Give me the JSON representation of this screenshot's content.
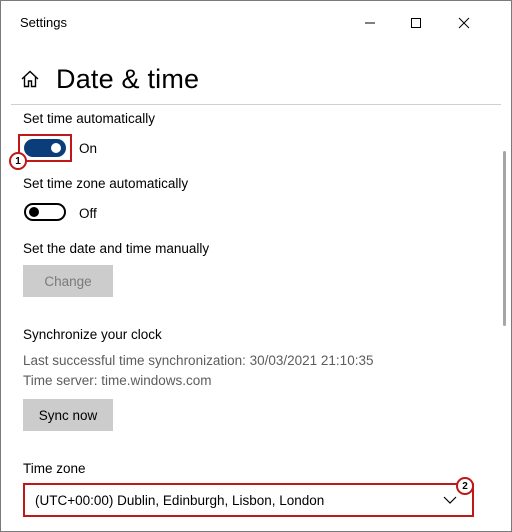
{
  "window": {
    "title": "Settings",
    "controls": {
      "minimize": "minimize-icon",
      "maximize": "maximize-icon",
      "close": "close-icon"
    }
  },
  "header": {
    "title": "Date & time",
    "icon": "home-icon"
  },
  "settings": {
    "set_time_auto": {
      "label": "Set time automatically",
      "state": "On",
      "enabled": true
    },
    "set_timezone_auto": {
      "label": "Set time zone automatically",
      "state": "Off",
      "enabled": false
    },
    "manual": {
      "label": "Set the date and time manually",
      "button": "Change"
    },
    "sync": {
      "heading": "Synchronize your clock",
      "last_sync": "Last successful time synchronization: 30/03/2021 21:10:35",
      "server": "Time server: time.windows.com",
      "button": "Sync now"
    },
    "timezone": {
      "label": "Time zone",
      "value": "(UTC+00:00) Dublin, Edinburgh, Lisbon, London"
    }
  },
  "annotations": {
    "marker1": "1",
    "marker2": "2"
  },
  "colors": {
    "accent": "#0a3d7a",
    "annotation": "#c01818",
    "button_bg": "#cccccc"
  }
}
